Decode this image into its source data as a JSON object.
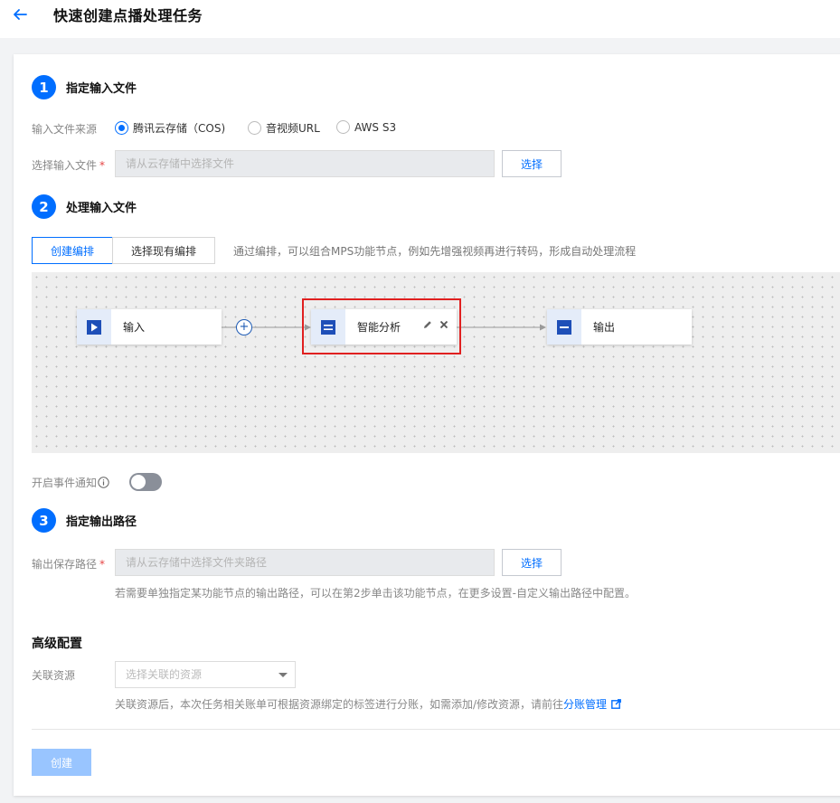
{
  "header": {
    "title": "快速创建点播处理任务"
  },
  "step1": {
    "number": "1",
    "title": "指定输入文件",
    "source_label": "输入文件来源",
    "source_options": [
      "腾讯云存储（COS)",
      "音视频URL",
      "AWS S3"
    ],
    "selected_source": "腾讯云存储（COS)",
    "file_label": "选择输入文件",
    "file_placeholder": "请从云存储中选择文件",
    "select_button": "选择"
  },
  "step2": {
    "number": "2",
    "title": "处理输入文件",
    "tabs": [
      "创建编排",
      "选择现有编排"
    ],
    "hint": "通过编排，可以组合MPS功能节点，例如先增强视频再进行转码，形成自动处理流程",
    "nodes": {
      "input": "输入",
      "analysis": "智能分析",
      "output": "输出"
    },
    "event_label": "开启事件通知",
    "event_enabled": false
  },
  "step3": {
    "number": "3",
    "title": "指定输出路径",
    "path_label": "输出保存路径",
    "path_placeholder": "请从云存储中选择文件夹路径",
    "select_button": "选择",
    "help": "若需要单独指定某功能节点的输出路径，可以在第2步单击该功能节点，在更多设置-自定义输出路径中配置。"
  },
  "advanced": {
    "title": "高级配置",
    "resource_label": "关联资源",
    "resource_placeholder": "选择关联的资源",
    "help_text": "关联资源后，本次任务相关账单可根据资源绑定的标签进行分账，如需添加/修改资源，请前往",
    "help_link": "分账管理"
  },
  "footer": {
    "create_button": "创建"
  },
  "colors": {
    "primary": "#006eff",
    "highlight": "#e02020",
    "disabled_button": "#99c5ff"
  }
}
